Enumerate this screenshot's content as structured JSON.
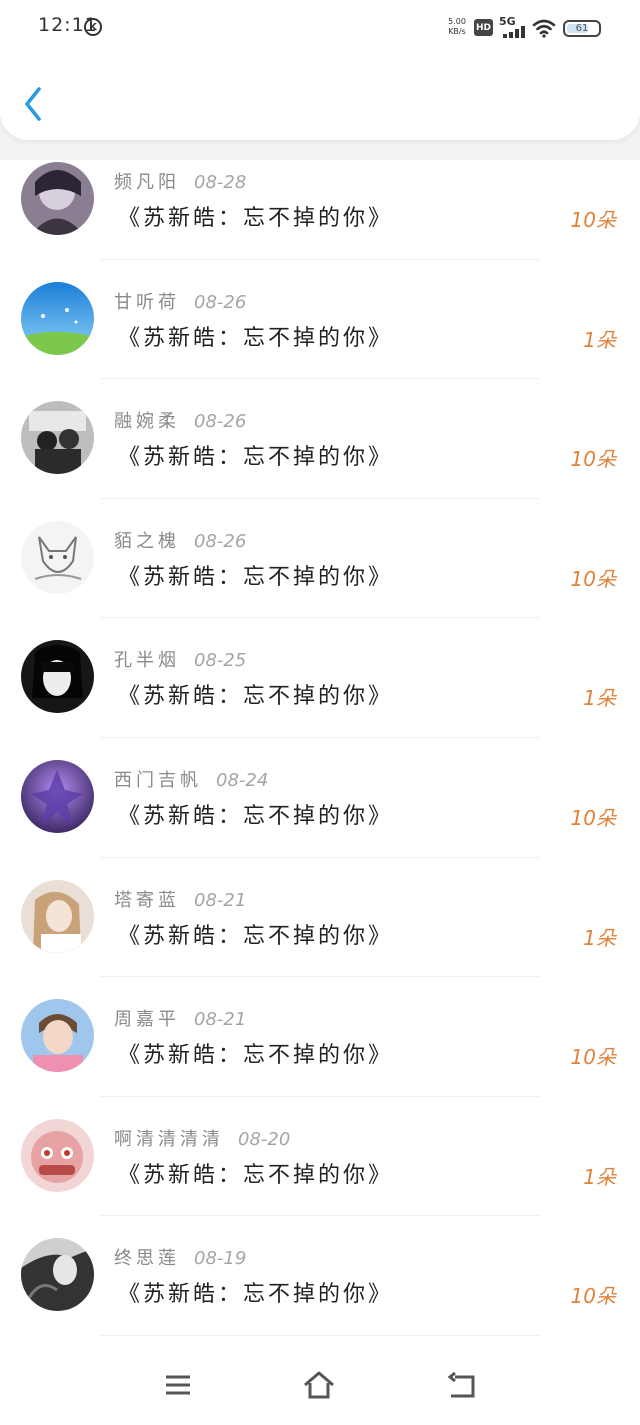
{
  "status_bar": {
    "time": "12:11",
    "k_badge": "K",
    "net_speed_value": "5.00",
    "net_speed_unit": "KB/s",
    "hd_badge": "HD",
    "network_type": "5G",
    "battery_level": "61"
  },
  "nav": {
    "back_icon": "chevron-left-icon",
    "accent_color": "#2a9be0"
  },
  "colors": {
    "count_color": "#e0833a",
    "name_color": "#8a8a8a",
    "title_color": "#222222"
  },
  "items": [
    {
      "name": "频凡阳",
      "date": "08-28",
      "title": "《苏新皓：忘不掉的你》",
      "count": "10朵"
    },
    {
      "name": "甘听荷",
      "date": "08-26",
      "title": "《苏新皓：忘不掉的你》",
      "count": "1朵"
    },
    {
      "name": "融婉柔",
      "date": "08-26",
      "title": "《苏新皓：忘不掉的你》",
      "count": "10朵"
    },
    {
      "name": "貊之槐",
      "date": "08-26",
      "title": "《苏新皓：忘不掉的你》",
      "count": "10朵"
    },
    {
      "name": "孔半烟",
      "date": "08-25",
      "title": "《苏新皓：忘不掉的你》",
      "count": "1朵"
    },
    {
      "name": "西门吉帆",
      "date": "08-24",
      "title": "《苏新皓：忘不掉的你》",
      "count": "10朵"
    },
    {
      "name": "塔寄蓝",
      "date": "08-21",
      "title": "《苏新皓：忘不掉的你》",
      "count": "1朵"
    },
    {
      "name": "周嘉平",
      "date": "08-21",
      "title": "《苏新皓：忘不掉的你》",
      "count": "10朵"
    },
    {
      "name": "啊清清清清",
      "date": "08-20",
      "title": "《苏新皓：忘不掉的你》",
      "count": "1朵"
    },
    {
      "name": "终思莲",
      "date": "08-19",
      "title": "《苏新皓：忘不掉的你》",
      "count": "10朵"
    }
  ],
  "bottom_nav": {
    "icons": [
      "menu-icon",
      "home-icon",
      "back-icon"
    ]
  }
}
